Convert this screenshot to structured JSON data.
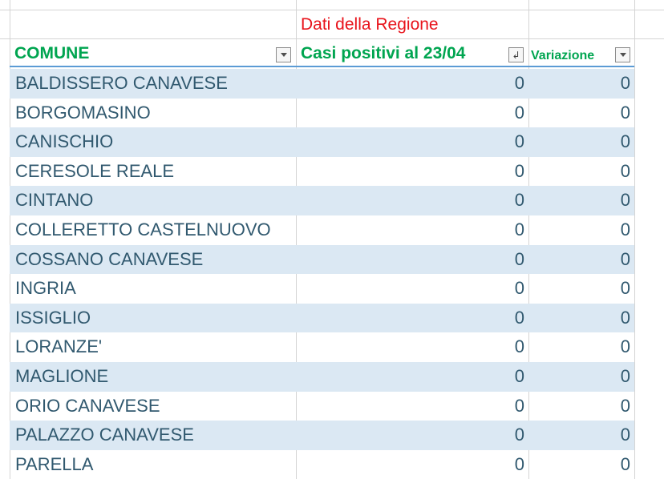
{
  "sheet": {
    "region_title": "Dati della Regione",
    "headers": [
      {
        "label": "COMUNE",
        "filter_icon": "dropdown-arrow-icon"
      },
      {
        "label": "Casi positivi al 23/04",
        "filter_icon": "sort-filter-icon"
      },
      {
        "label": "Variazione",
        "filter_icon": "dropdown-arrow-icon"
      }
    ],
    "rows": [
      {
        "comune": "BALDISSERO CANAVESE",
        "casi": "0",
        "variazione": "0"
      },
      {
        "comune": "BORGOMASINO",
        "casi": "0",
        "variazione": "0"
      },
      {
        "comune": "CANISCHIO",
        "casi": "0",
        "variazione": "0"
      },
      {
        "comune": "CERESOLE REALE",
        "casi": "0",
        "variazione": "0"
      },
      {
        "comune": "CINTANO",
        "casi": "0",
        "variazione": "0"
      },
      {
        "comune": "COLLERETTO CASTELNUOVO",
        "casi": "0",
        "variazione": "0"
      },
      {
        "comune": "COSSANO CANAVESE",
        "casi": "0",
        "variazione": "0"
      },
      {
        "comune": "INGRIA",
        "casi": "0",
        "variazione": "0"
      },
      {
        "comune": "ISSIGLIO",
        "casi": "0",
        "variazione": "0"
      },
      {
        "comune": "LORANZE'",
        "casi": "0",
        "variazione": "0"
      },
      {
        "comune": "MAGLIONE",
        "casi": "0",
        "variazione": "0"
      },
      {
        "comune": "ORIO CANAVESE",
        "casi": "0",
        "variazione": "0"
      },
      {
        "comune": "PALAZZO CANAVESE",
        "casi": "0",
        "variazione": "0"
      },
      {
        "comune": "PARELLA",
        "casi": "0",
        "variazione": "0"
      }
    ]
  },
  "colors": {
    "region_title": "#e8131b",
    "header_text": "#00a550",
    "header_border": "#5b9bd5",
    "band_fill": "#dbe8f3",
    "cell_text": "#31596f",
    "gridline": "#d4d4d4"
  }
}
